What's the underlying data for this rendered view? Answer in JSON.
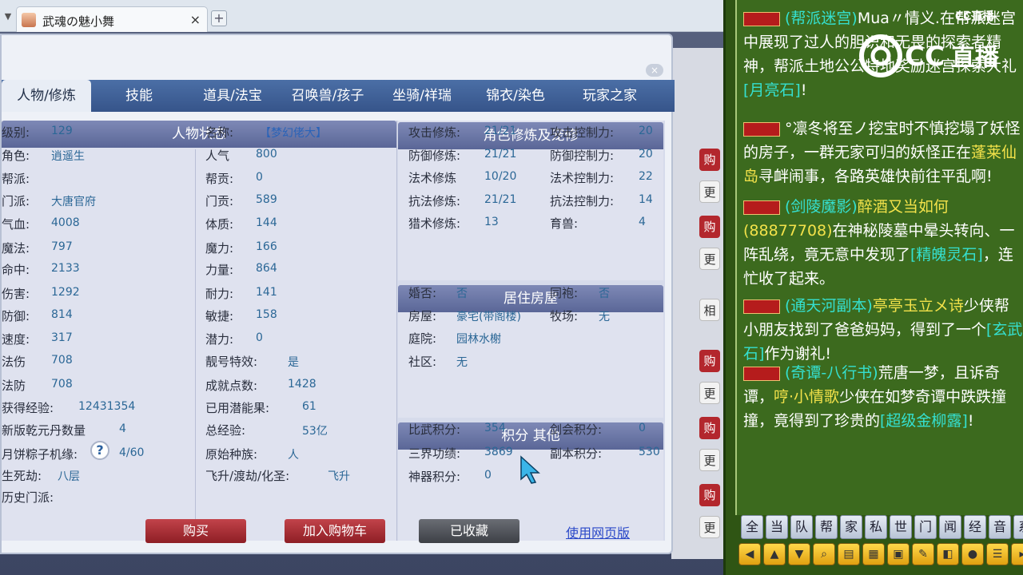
{
  "browser": {
    "tab_title": "武魂の魅小舞",
    "close": "×",
    "add": "+"
  },
  "nav": {
    "tabs": [
      "人物/修炼",
      "技能",
      "道具/法宝",
      "召唤兽/孩子",
      "坐骑/祥瑞",
      "锦衣/染色",
      "玩家之家"
    ]
  },
  "status": {
    "title": "人物状态",
    "left": [
      {
        "label": "级别:",
        "value": "129"
      },
      {
        "label": "角色:",
        "value": "逍遥生"
      },
      {
        "label": "帮派:",
        "value": ""
      },
      {
        "label": "门派:",
        "value": "大唐官府"
      },
      {
        "label": "气血:",
        "value": "4008"
      },
      {
        "label": "魔法:",
        "value": "797"
      },
      {
        "label": "命中:",
        "value": "2133"
      },
      {
        "label": "伤害:",
        "value": "1292"
      },
      {
        "label": "防御:",
        "value": "814"
      },
      {
        "label": "速度:",
        "value": "317"
      },
      {
        "label": "法伤",
        "value": "708"
      },
      {
        "label": "法防",
        "value": "708"
      },
      {
        "label": "获得经验:",
        "value": "12431354"
      },
      {
        "label": "新版乾元丹数量",
        "value": "4"
      },
      {
        "label": "月饼粽子机缘:",
        "value": "4/60"
      },
      {
        "label": "生死劫:",
        "value": "八层"
      },
      {
        "label": "历史门派:",
        "value": ""
      }
    ],
    "right": [
      {
        "label": "名称:",
        "value": "【梦幻佬大】"
      },
      {
        "label": "人气",
        "value": "800"
      },
      {
        "label": "帮贡:",
        "value": "0"
      },
      {
        "label": "门贡:",
        "value": "589"
      },
      {
        "label": "体质:",
        "value": "144"
      },
      {
        "label": "魔力:",
        "value": "166"
      },
      {
        "label": "力量:",
        "value": "864"
      },
      {
        "label": "耐力:",
        "value": "141"
      },
      {
        "label": "敏捷:",
        "value": "158"
      },
      {
        "label": "潜力:",
        "value": "0"
      },
      {
        "label": "靓号特效:",
        "value": "是"
      },
      {
        "label": "成就点数:",
        "value": "1428"
      },
      {
        "label": "已用潜能果:",
        "value": "61"
      },
      {
        "label": "总经验:",
        "value": "53亿"
      },
      {
        "label": "原始种族:",
        "value": "人"
      },
      {
        "label": "飞升/渡劫/化圣:",
        "value": "飞升"
      }
    ],
    "help": "?"
  },
  "cultivation": {
    "title": "角色修炼及宠修",
    "rows": [
      {
        "l1": "攻击修炼:",
        "v1": "21/21",
        "l2": "攻击控制力:",
        "v2": "20"
      },
      {
        "l1": "防御修炼:",
        "v1": "21/21",
        "l2": "防御控制力:",
        "v2": "20"
      },
      {
        "l1": "法术修炼",
        "v1": "10/20",
        "l2": "法术控制力:",
        "v2": "22"
      },
      {
        "l1": "抗法修炼:",
        "v1": "21/21",
        "l2": "抗法控制力:",
        "v2": "14"
      },
      {
        "l1": "猎术修炼:",
        "v1": "13",
        "l2": "育兽:",
        "v2": "4"
      }
    ]
  },
  "housing": {
    "title": "居住房屋",
    "rows": [
      {
        "l1": "婚否:",
        "v1": "否",
        "l2": "同袍:",
        "v2": "否"
      },
      {
        "l1": "房屋:",
        "v1": "豪宅(带阁楼)",
        "l2": "牧场:",
        "v2": "无"
      },
      {
        "l1": "庭院:",
        "v1": "园林水榭",
        "l2": "",
        "v2": ""
      },
      {
        "l1": "社区:",
        "v1": "无",
        "l2": "",
        "v2": ""
      }
    ]
  },
  "points": {
    "title": "积分 其他",
    "rows": [
      {
        "l1": "比武积分:",
        "v1": "354",
        "l2": "剑会积分:",
        "v2": "0"
      },
      {
        "l1": "三界功绩:",
        "v1": "3869",
        "l2": "副本积分:",
        "v2": "530"
      },
      {
        "l1": "神器积分:",
        "v1": "0",
        "l2": "",
        "v2": ""
      }
    ]
  },
  "footer": {
    "buy": "购买",
    "add_cart": "加入购物车",
    "favorited": "已收藏",
    "web_version": "使用网页版"
  },
  "bg_buttons": [
    "购",
    "更",
    "购",
    "更",
    "相",
    "购",
    "更",
    "购",
    "更",
    "购",
    "更"
  ],
  "chat": {
    "brand": "CC直播",
    "messages": [
      {
        "tag": "系统",
        "a": "(帮派迷宫)",
        "b": "Mua〃情义.",
        "c": "在帮派迷宫中展现了过人的胆识和无畏的探索者精神，帮派土地公公特地奖励",
        "d": "迷宫探索大礼",
        "e": "[月亮石]",
        "f": "!"
      },
      {
        "tag": "系统",
        "a": "°凛冬将至ノ",
        "b": "挖宝时不慎挖塌了妖怪的房子，一群无家可归的妖怪正在",
        "c": "蓬莱仙岛",
        "d": "寻衅闹事，各路英雄快前往平乱啊!"
      },
      {
        "tag": "系统",
        "a": "(剑陵魔影)",
        "b": "醉酒又当如何",
        "c": "(888",
        "d": "77708)",
        "e": "在神秘陵墓中晕头转向、一阵乱绕，竟无意中发现了",
        "f": "[精魄灵石]",
        "g": "，连忙收了起来。"
      },
      {
        "tag": "系统",
        "a": "(通天河副本)",
        "b": "亭亭玉立メ诗",
        "c": "少侠帮小朋友找到了爸爸妈妈，得到了一个",
        "d": "[玄武石]",
        "e": "作为谢礼!"
      },
      {
        "tag": "系统",
        "a": "(奇谭-八行书)",
        "b": "荒唐一梦，且诉奇谭，",
        "c": "哼·小情歌",
        "d": "少侠在如梦奇谭中跌跌撞撞，竟得到了珍贵的",
        "e": "[超级金柳露]",
        "f": "!"
      }
    ],
    "channels": [
      "全",
      "当",
      "队",
      "帮",
      "家",
      "私",
      "世",
      "门",
      "闻",
      "经",
      "音",
      "系"
    ]
  }
}
